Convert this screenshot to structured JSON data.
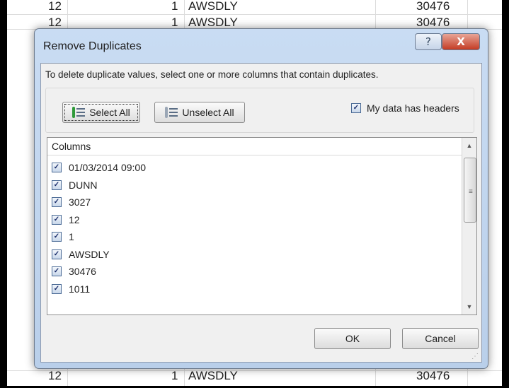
{
  "sheet": {
    "top_row": {
      "col_a": "12",
      "col_b": "1",
      "col_c": "AWSDLY",
      "col_d": "30476"
    },
    "second_row": {
      "col_a": "12",
      "col_b": "1",
      "col_c": "AWSDLY",
      "col_d": "30476"
    },
    "bottom_row": {
      "col_a": "12",
      "col_b": "1",
      "col_c": "AWSDLY",
      "col_d": "30476"
    }
  },
  "dialog": {
    "title": "Remove Duplicates",
    "help_label": "?",
    "close_label": "X",
    "instruction": "To delete duplicate values, select one or more columns that contain duplicates.",
    "select_all_label": "Select All",
    "unselect_all_label": "Unselect All",
    "has_headers_label": "My data has headers",
    "has_headers_checked": true,
    "columns_header": "Columns",
    "columns": [
      {
        "label": "01/03/2014 09:00",
        "checked": true
      },
      {
        "label": "DUNN",
        "checked": true
      },
      {
        "label": "3027",
        "checked": true
      },
      {
        "label": "12",
        "checked": true
      },
      {
        "label": "1",
        "checked": true
      },
      {
        "label": "AWSDLY",
        "checked": true
      },
      {
        "label": "30476",
        "checked": true
      },
      {
        "label": "1011",
        "checked": true
      }
    ],
    "ok_label": "OK",
    "cancel_label": "Cancel"
  },
  "colors": {
    "dialog_frame": "#b9cfea",
    "close_button": "#c43c24",
    "client_bg": "#f0f0f0"
  }
}
